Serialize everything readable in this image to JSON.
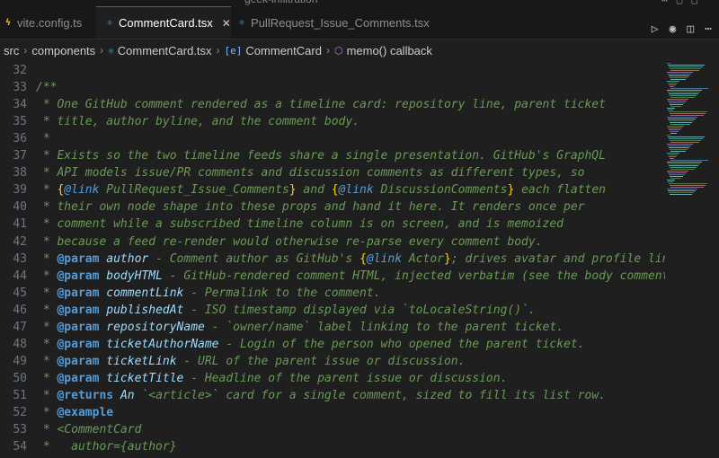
{
  "window": {
    "title": "geek-infiltration"
  },
  "tabs": [
    {
      "label": "vite.config.ts",
      "icon": "TS",
      "icon_color": "#e2b93d",
      "active": false
    },
    {
      "label": "CommentCard.tsx",
      "icon": "TS",
      "icon_color": "#4fa8d8",
      "active": true
    },
    {
      "label": "PullRequest_Issue_Comments.tsx",
      "icon": "TS",
      "icon_color": "#4fa8d8",
      "active": false
    }
  ],
  "breadcrumb": [
    {
      "label": "src",
      "icon": ""
    },
    {
      "label": "components",
      "icon": ""
    },
    {
      "label": "CommentCard.tsx",
      "icon": "TS"
    },
    {
      "label": "CommentCard",
      "icon": "[e]"
    },
    {
      "label": "memo() callback",
      "icon": "⬡"
    }
  ],
  "editor": {
    "lines": [
      {
        "n": "32",
        "text": ""
      },
      {
        "n": "33",
        "text": "/**"
      },
      {
        "n": "34",
        "text": " * One GitHub comment rendered as a timeline card: repository line, parent ticket"
      },
      {
        "n": "35",
        "text": " * title, author byline, and the comment body."
      },
      {
        "n": "36",
        "text": " *"
      },
      {
        "n": "37",
        "text": " * Exists so the two timeline feeds share a single presentation. GitHub's GraphQL"
      },
      {
        "n": "38",
        "text": " * API models issue/PR comments and discussion comments as different types, so"
      },
      {
        "n": "39",
        "text": " * {@link PullRequest_Issue_Comments} and {@link DiscussionComments} each flatten"
      },
      {
        "n": "40",
        "text": " * their own node shape into these props and hand it here. It renders once per"
      },
      {
        "n": "41",
        "text": " * comment while a subscribed timeline column is on screen, and is memoized"
      },
      {
        "n": "42",
        "text": " * because a feed re-render would otherwise re-parse every comment body."
      },
      {
        "n": "43",
        "text": " * @param author - Comment author as GitHub's {@link Actor}; drives avatar and profile link."
      },
      {
        "n": "44",
        "text": " * @param bodyHTML - GitHub-rendered comment HTML, injected verbatim (see the body comment bel"
      },
      {
        "n": "45",
        "text": " * @param commentLink - Permalink to the comment."
      },
      {
        "n": "46",
        "text": " * @param publishedAt - ISO timestamp displayed via `toLocaleString()`."
      },
      {
        "n": "47",
        "text": " * @param repositoryName - `owner/name` label linking to the parent ticket."
      },
      {
        "n": "48",
        "text": " * @param ticketAuthorName - Login of the person who opened the parent ticket."
      },
      {
        "n": "49",
        "text": " * @param ticketLink - URL of the parent issue or discussion."
      },
      {
        "n": "50",
        "text": " * @param ticketTitle - Headline of the parent issue or discussion."
      },
      {
        "n": "51",
        "text": " * @returns An `<article>` card for a single comment, sized to fill its list row."
      },
      {
        "n": "52",
        "text": " * @example"
      },
      {
        "n": "53",
        "text": " * <CommentCard"
      },
      {
        "n": "54",
        "text": " *   author={author}"
      }
    ]
  },
  "colors": {
    "comment": "#6a9955",
    "tag": "#569cd6",
    "link_brace": "#ffd700",
    "accent": "#0078d4"
  }
}
